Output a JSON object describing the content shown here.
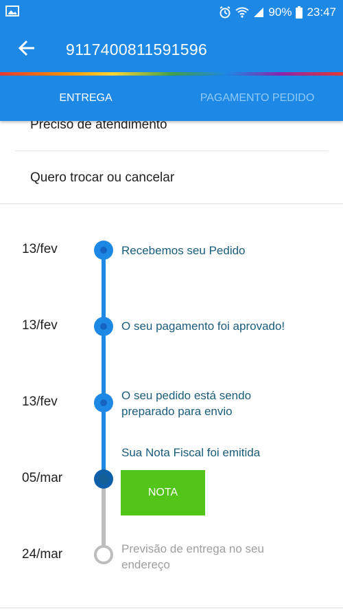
{
  "status_bar": {
    "battery": "90%",
    "time": "23:47",
    "icons": [
      "image-icon",
      "alarm-icon",
      "wifi-icon",
      "signal-icon",
      "battery-icon"
    ]
  },
  "app_bar": {
    "title": "9117400811591596",
    "back_icon": "arrow-left-icon"
  },
  "tabs": [
    {
      "label": "ENTREGA",
      "active": true
    },
    {
      "label": "PAGAMENTO PEDIDO",
      "active": false
    }
  ],
  "menu": {
    "items": [
      {
        "label": "Preciso de atendimento"
      },
      {
        "label": "Quero trocar ou cancelar"
      }
    ]
  },
  "timeline": {
    "events": [
      {
        "date": "13/fev",
        "label": "Recebemos seu Pedido",
        "state": "done"
      },
      {
        "date": "13/fev",
        "label": "O seu pagamento foi aprovado!",
        "state": "done"
      },
      {
        "date": "13/fev",
        "label": "O seu pedido está sendo preparado para envio",
        "state": "done"
      },
      {
        "date": "05/mar",
        "label": "Sua Nota Fiscal foi emitida",
        "state": "current",
        "button": "NOTA"
      },
      {
        "date": "24/mar",
        "label": "Previsão de entrega no seu endereço",
        "state": "future"
      }
    ]
  },
  "colors": {
    "primary": "#1e88e5",
    "accent_green": "#52c41a",
    "label_text": "#1a5c7a",
    "future_grey": "#bdbdbd"
  }
}
